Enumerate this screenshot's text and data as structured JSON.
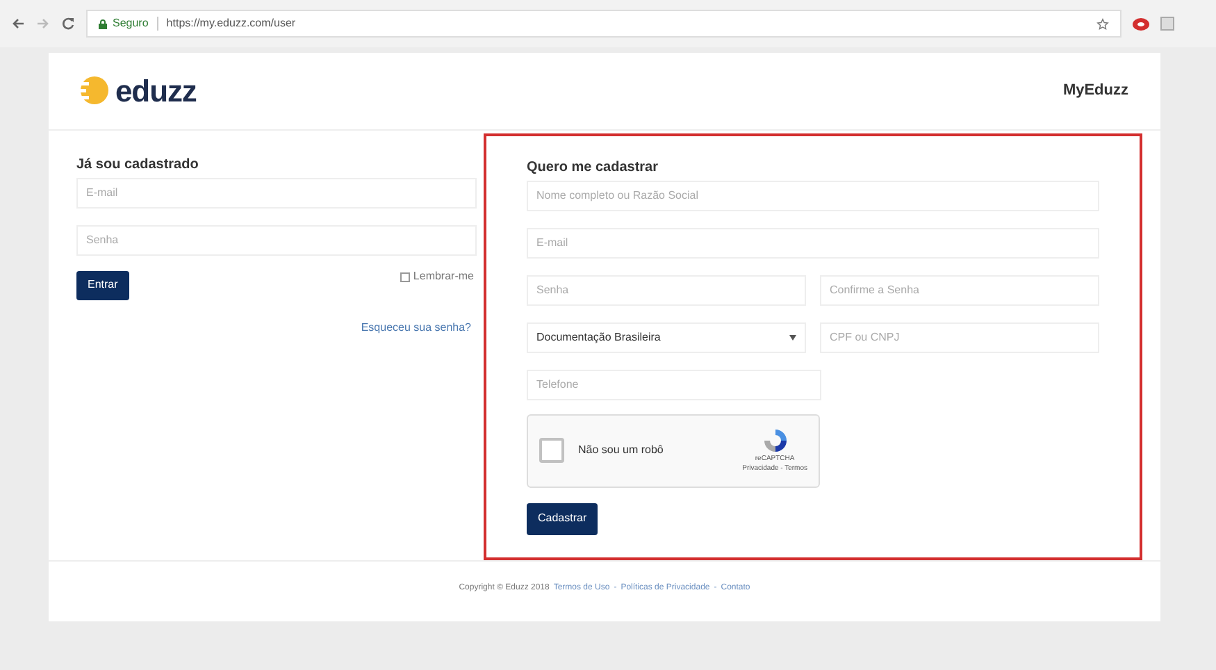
{
  "browser": {
    "security_label": "Seguro",
    "url": "https://my.eduzz.com/user"
  },
  "header": {
    "logo_text": "eduzz",
    "link": "MyEduzz"
  },
  "login": {
    "title": "Já sou cadastrado",
    "fields": [
      {
        "placeholder": "E-mail"
      },
      {
        "placeholder": "Senha"
      }
    ],
    "button": "Entrar",
    "remember": {
      "label": "Lembrar-me",
      "checked": false
    },
    "forgot": "Esqueceu sua senha?"
  },
  "signup": {
    "title": "Quero me cadastrar",
    "highlighted": true,
    "rows": [
      [
        {
          "kind": "input",
          "placeholder": "Nome completo ou Razão Social"
        }
      ],
      [
        {
          "kind": "input",
          "placeholder": "E-mail"
        }
      ],
      [
        {
          "kind": "input",
          "placeholder": "Senha"
        },
        {
          "kind": "input",
          "placeholder": "Confirme a Senha"
        }
      ],
      [
        {
          "kind": "select",
          "value": "Documentação Brasileira"
        },
        {
          "kind": "input",
          "placeholder": "CPF ou CNPJ"
        }
      ],
      [
        {
          "kind": "input",
          "placeholder": "Telefone"
        }
      ]
    ],
    "captcha": {
      "label": "Não sou um robô",
      "checked": false,
      "brand": "reCAPTCHA",
      "links": "Privacidade - Termos"
    },
    "button": "Cadastrar"
  },
  "footer": {
    "copyright": "Copyright © Eduzz 2018",
    "links": [
      "Termos de Uso",
      "Políticas de Privacidade",
      "Contato"
    ],
    "separator": "-"
  }
}
